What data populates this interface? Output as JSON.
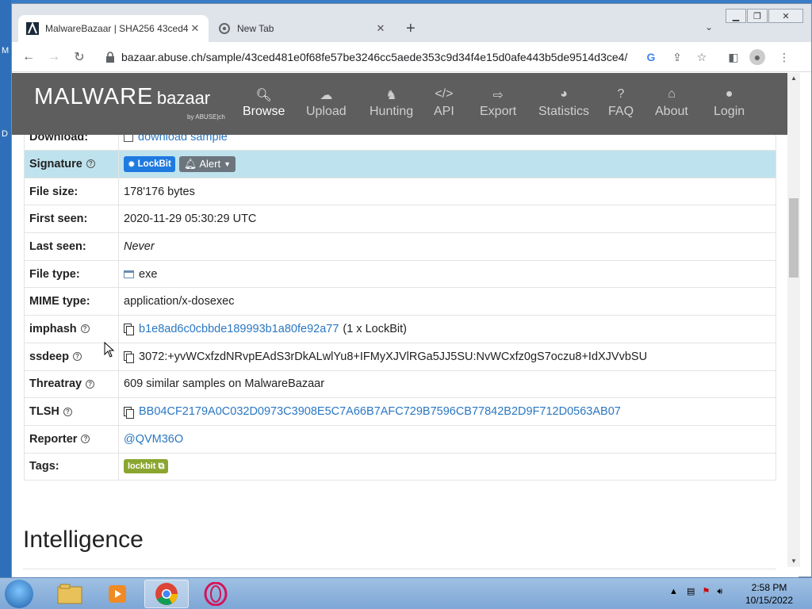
{
  "desktop": {
    "left_labels": [
      "M",
      "D"
    ]
  },
  "browser": {
    "tabs": [
      {
        "title": "MalwareBazaar | SHA256 43ced4",
        "active": true
      },
      {
        "title": "New Tab",
        "active": false
      }
    ],
    "address": "bazaar.abuse.ch/sample/43ced481e0f68fe57be3246cc5aede353c9d34f4e15d0afe443b5de9514d3ce4/"
  },
  "site": {
    "logo_main": "MALWARE",
    "logo_sub": "bazaar",
    "logo_by": "by ABUSE|ch",
    "nav": [
      {
        "label": "Browse",
        "icon": "search-icon",
        "active": true
      },
      {
        "label": "Upload",
        "icon": "upload-icon",
        "active": false
      },
      {
        "label": "Hunting",
        "icon": "hunting-icon",
        "active": false
      },
      {
        "label": "API",
        "icon": "code-icon",
        "active": false
      },
      {
        "label": "Export",
        "icon": "export-icon",
        "active": false
      },
      {
        "label": "Statistics",
        "icon": "pie-chart-icon",
        "active": false
      },
      {
        "label": "FAQ",
        "icon": "question-icon",
        "active": false
      },
      {
        "label": "About",
        "icon": "bank-icon",
        "active": false
      },
      {
        "label": "Login",
        "icon": "user-icon",
        "active": false
      }
    ]
  },
  "details": {
    "download_label": "Download:",
    "download_link": "download sample",
    "signature_label": "Signature",
    "signature_badge": "LockBit",
    "alert_button": "Alert",
    "filesize_label": "File size:",
    "filesize": "178'176 bytes",
    "firstseen_label": "First seen:",
    "firstseen": "2020-11-29 05:30:29 UTC",
    "lastseen_label": "Last seen:",
    "lastseen": "Never",
    "filetype_label": "File type:",
    "filetype": "exe",
    "mime_label": "MIME type:",
    "mime": "application/x-dosexec",
    "imphash_label": "imphash",
    "imphash": "b1e8ad6c0cbbde189993b1a80fe92a77",
    "imphash_note": "(1 x LockBit)",
    "ssdeep_label": "ssdeep",
    "ssdeep": "3072:+yvWCxfzdNRvpEAdS3rDkALwlYu8+IFMyXJVlRGa5JJ5SU:NvWCxfz0gS7oczu8+IdXJVvbSU",
    "threatray_label": "Threatray",
    "threatray": "609 similar samples on MalwareBazaar",
    "tlsh_label": "TLSH",
    "tlsh": "BB04CF2179A0C032D0973C3908E5C7A66B7AFC729B7596CB77842B2D9F712D0563AB07",
    "reporter_label": "Reporter",
    "reporter": "@QVM36O",
    "tags_label": "Tags:",
    "tag": "lockbit"
  },
  "section_heading": "Intelligence",
  "taskbar": {
    "time": "2:58 PM",
    "date": "10/15/2022"
  }
}
